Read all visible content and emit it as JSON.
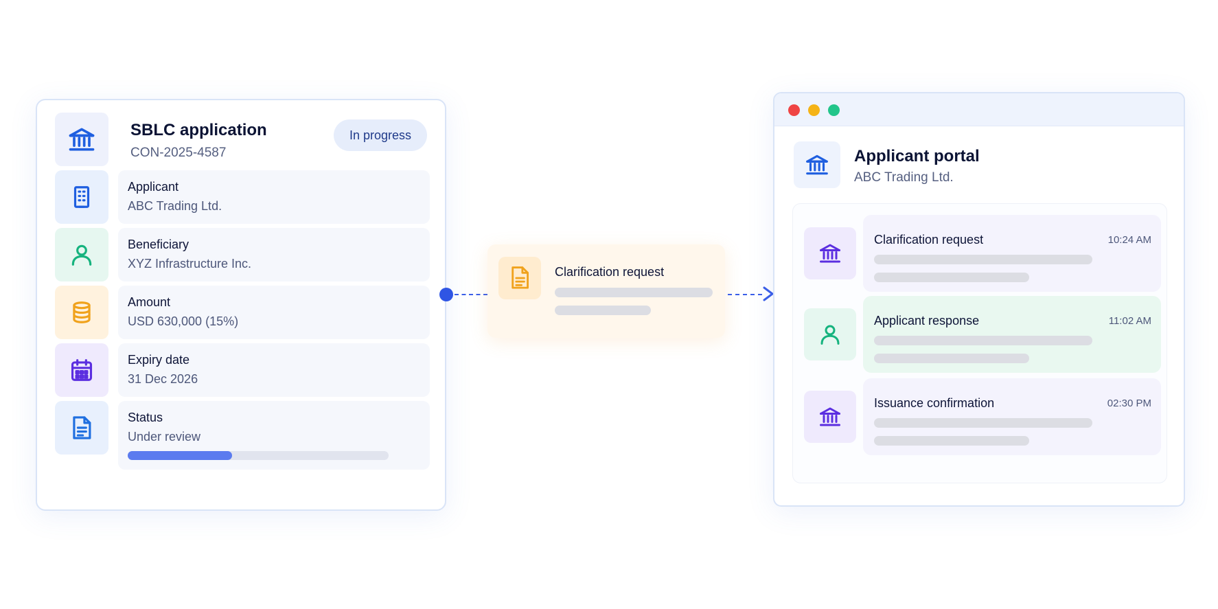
{
  "application": {
    "title": "SBLC application",
    "reference": "CON-2025-4587",
    "badge": "In progress",
    "icon": "bank-icon",
    "fields": [
      {
        "label": "Applicant",
        "value": "ABC Trading Ltd.",
        "icon": "building-icon",
        "color": "#1f5fe0",
        "bg": "#e8f0fd"
      },
      {
        "label": "Beneficiary",
        "value": "XYZ Infrastructure Inc.",
        "icon": "person-icon",
        "color": "#16b37e",
        "bg": "#e6f7f0"
      },
      {
        "label": "Amount",
        "value": "USD 630,000 (15%)",
        "icon": "coins-icon",
        "color": "#f0a21c",
        "bg": "#fff2de"
      },
      {
        "label": "Expiry date",
        "value": "31 Dec 2026",
        "icon": "calendar-icon",
        "color": "#5b2ee0",
        "bg": "#efeafd"
      },
      {
        "label": "Status",
        "value": "Under review",
        "icon": "document-icon",
        "color": "#1f6fe0",
        "bg": "#e8f0fd",
        "progress": 0.4
      }
    ]
  },
  "message": {
    "title": "Clarification request",
    "icon": "document-icon"
  },
  "portal": {
    "title": "Applicant portal",
    "subtitle": "ABC Trading Ltd.",
    "icon": "bank-icon",
    "window_controls": [
      "#ef4444",
      "#f5b316",
      "#22c58a"
    ],
    "events": [
      {
        "title": "Clarification request",
        "time": "10:24 AM",
        "icon": "bank-icon",
        "color": "#5b2ee0",
        "icon_bg": "#efeafd",
        "box_bg": "#f4f3fd"
      },
      {
        "title": "Applicant response",
        "time": "11:02 AM",
        "icon": "person-icon",
        "color": "#16b37e",
        "icon_bg": "#e6f7f0",
        "box_bg": "#e9f8f0"
      },
      {
        "title": "Issuance confirmation",
        "time": "02:30 PM",
        "icon": "bank-icon",
        "color": "#5b2ee0",
        "icon_bg": "#efeafd",
        "box_bg": "#f4f3fd"
      }
    ]
  }
}
